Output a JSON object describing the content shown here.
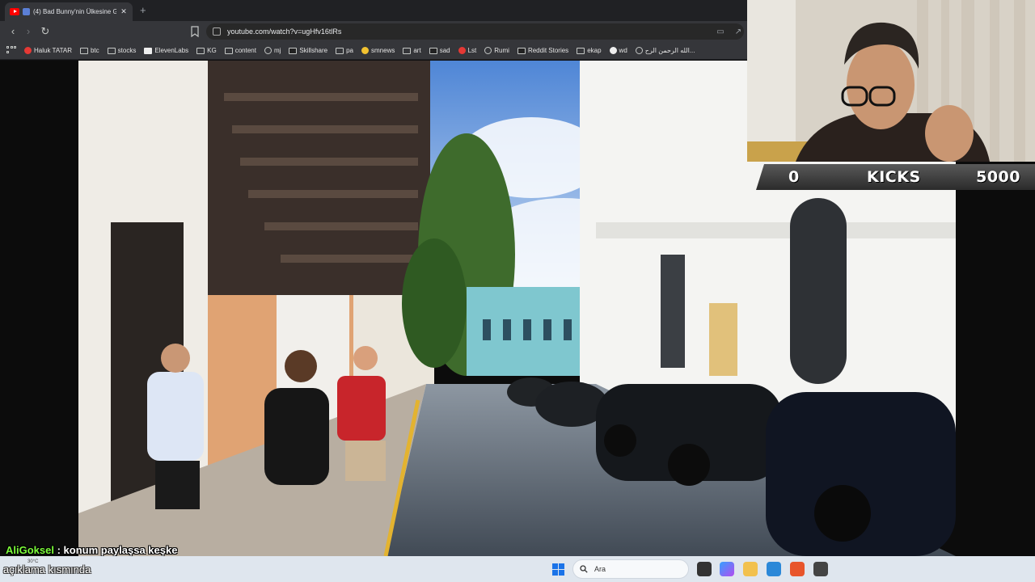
{
  "browser": {
    "tab": {
      "title": "(4) Bad Bunny'nin Ülkesine G...",
      "close": "✕"
    },
    "new_tab": "+",
    "url": "youtube.com/watch?v=ugHfv16tlRs",
    "bookmarks": [
      {
        "label": "Haluk TATAR",
        "icon": "youtube-icon"
      },
      {
        "label": "btc",
        "icon": "folder-icon"
      },
      {
        "label": "stocks",
        "icon": "folder-icon"
      },
      {
        "label": "ElevenLabs",
        "icon": "elevenlabs-icon"
      },
      {
        "label": "KG",
        "icon": "folder-icon"
      },
      {
        "label": "content",
        "icon": "folder-icon"
      },
      {
        "label": "mj",
        "icon": "github-icon"
      },
      {
        "label": "Skillshare",
        "icon": "skillshare-icon"
      },
      {
        "label": "pa",
        "icon": "folder-icon"
      },
      {
        "label": "smnews",
        "icon": "smiley-icon"
      },
      {
        "label": "art",
        "icon": "folder-icon"
      },
      {
        "label": "sad",
        "icon": "slash-icon"
      },
      {
        "label": "Lst",
        "icon": "s-red-icon"
      },
      {
        "label": "Rumi",
        "icon": "globe-icon"
      },
      {
        "label": "Reddit Stories",
        "icon": "d-icon"
      },
      {
        "label": "ekap",
        "icon": "feather-icon"
      },
      {
        "label": "wd",
        "icon": "wd-icon"
      },
      {
        "label": "الله الرحمن الرح...",
        "icon": "globe-icon"
      }
    ]
  },
  "stream": {
    "kicks": {
      "left": "0",
      "label": "KICKS",
      "right": "5000"
    },
    "chat": {
      "username": "AliGoksel",
      "separator": " : ",
      "message": "konum paylaşsa keşke"
    },
    "chat_line2": "açıklama kısmında"
  },
  "taskbar": {
    "weather": "30°C",
    "search_placeholder": "Ara"
  },
  "colors": {
    "chat_username": "#7cfc3a",
    "taskbar_bg": "#dfe6ee",
    "kicks_bar": "#3a3a3a"
  }
}
